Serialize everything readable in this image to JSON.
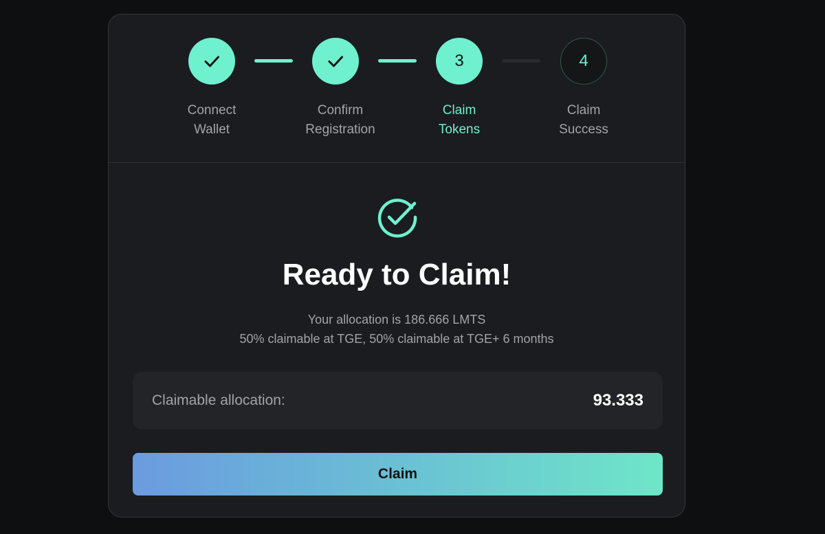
{
  "stepper": {
    "steps": [
      {
        "number": "1",
        "label_line1": "Connect",
        "label_line2": "Wallet",
        "status": "done"
      },
      {
        "number": "2",
        "label_line1": "Confirm",
        "label_line2": "Registration",
        "status": "done"
      },
      {
        "number": "3",
        "label_line1": "Claim",
        "label_line2": "Tokens",
        "status": "active"
      },
      {
        "number": "4",
        "label_line1": "Claim",
        "label_line2": "Success",
        "status": "pending"
      }
    ],
    "active_step": 3
  },
  "main": {
    "icon": "check-circle-icon",
    "title": "Ready to Claim!",
    "allocation_text": "Your allocation is 186.666 LMTS",
    "vesting_text": "50% claimable at TGE, 50% claimable at TGE+ 6 months",
    "claimable_label": "Claimable allocation:",
    "claimable_value": "93.333",
    "claim_button_label": "Claim"
  },
  "colors": {
    "accent": "#6ff0cf",
    "background": "#0e0f10",
    "card": "#1b1c1f",
    "button_gradient_start": "#6b9be0",
    "button_gradient_end": "#6ee6c8"
  }
}
